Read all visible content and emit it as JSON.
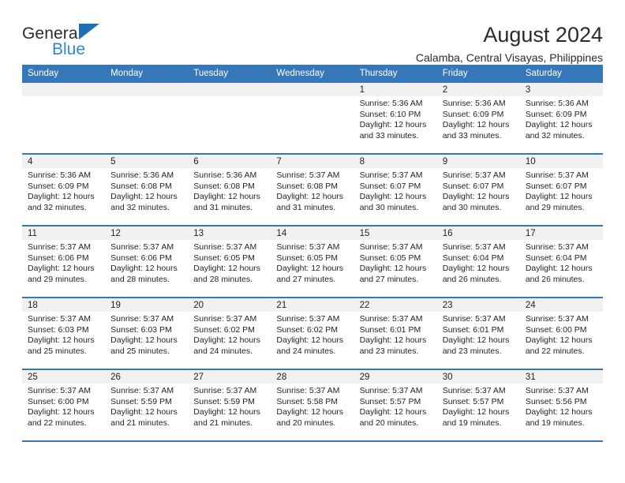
{
  "brand": {
    "name_top": "General",
    "name_bottom": "Blue",
    "triangle_color": "#1f6fb5",
    "text_color": "#2b2b2b",
    "accent_color": "#2e86d6"
  },
  "header": {
    "title": "August 2024",
    "subtitle": "Calamba, Central Visayas, Philippines"
  },
  "calendar": {
    "header_bg": "#3577b9",
    "header_text_color": "#ffffff",
    "daynum_band_bg": "#f1f1f1",
    "weekdays": [
      "Sunday",
      "Monday",
      "Tuesday",
      "Wednesday",
      "Thursday",
      "Friday",
      "Saturday"
    ],
    "weeks": [
      [
        {
          "day": "",
          "sunrise": "",
          "sunset": "",
          "daylight_line1": "",
          "daylight_line2": ""
        },
        {
          "day": "",
          "sunrise": "",
          "sunset": "",
          "daylight_line1": "",
          "daylight_line2": ""
        },
        {
          "day": "",
          "sunrise": "",
          "sunset": "",
          "daylight_line1": "",
          "daylight_line2": ""
        },
        {
          "day": "",
          "sunrise": "",
          "sunset": "",
          "daylight_line1": "",
          "daylight_line2": ""
        },
        {
          "day": "1",
          "sunrise": "Sunrise: 5:36 AM",
          "sunset": "Sunset: 6:10 PM",
          "daylight_line1": "Daylight: 12 hours",
          "daylight_line2": "and 33 minutes."
        },
        {
          "day": "2",
          "sunrise": "Sunrise: 5:36 AM",
          "sunset": "Sunset: 6:09 PM",
          "daylight_line1": "Daylight: 12 hours",
          "daylight_line2": "and 33 minutes."
        },
        {
          "day": "3",
          "sunrise": "Sunrise: 5:36 AM",
          "sunset": "Sunset: 6:09 PM",
          "daylight_line1": "Daylight: 12 hours",
          "daylight_line2": "and 32 minutes."
        }
      ],
      [
        {
          "day": "4",
          "sunrise": "Sunrise: 5:36 AM",
          "sunset": "Sunset: 6:09 PM",
          "daylight_line1": "Daylight: 12 hours",
          "daylight_line2": "and 32 minutes."
        },
        {
          "day": "5",
          "sunrise": "Sunrise: 5:36 AM",
          "sunset": "Sunset: 6:08 PM",
          "daylight_line1": "Daylight: 12 hours",
          "daylight_line2": "and 32 minutes."
        },
        {
          "day": "6",
          "sunrise": "Sunrise: 5:36 AM",
          "sunset": "Sunset: 6:08 PM",
          "daylight_line1": "Daylight: 12 hours",
          "daylight_line2": "and 31 minutes."
        },
        {
          "day": "7",
          "sunrise": "Sunrise: 5:37 AM",
          "sunset": "Sunset: 6:08 PM",
          "daylight_line1": "Daylight: 12 hours",
          "daylight_line2": "and 31 minutes."
        },
        {
          "day": "8",
          "sunrise": "Sunrise: 5:37 AM",
          "sunset": "Sunset: 6:07 PM",
          "daylight_line1": "Daylight: 12 hours",
          "daylight_line2": "and 30 minutes."
        },
        {
          "day": "9",
          "sunrise": "Sunrise: 5:37 AM",
          "sunset": "Sunset: 6:07 PM",
          "daylight_line1": "Daylight: 12 hours",
          "daylight_line2": "and 30 minutes."
        },
        {
          "day": "10",
          "sunrise": "Sunrise: 5:37 AM",
          "sunset": "Sunset: 6:07 PM",
          "daylight_line1": "Daylight: 12 hours",
          "daylight_line2": "and 29 minutes."
        }
      ],
      [
        {
          "day": "11",
          "sunrise": "Sunrise: 5:37 AM",
          "sunset": "Sunset: 6:06 PM",
          "daylight_line1": "Daylight: 12 hours",
          "daylight_line2": "and 29 minutes."
        },
        {
          "day": "12",
          "sunrise": "Sunrise: 5:37 AM",
          "sunset": "Sunset: 6:06 PM",
          "daylight_line1": "Daylight: 12 hours",
          "daylight_line2": "and 28 minutes."
        },
        {
          "day": "13",
          "sunrise": "Sunrise: 5:37 AM",
          "sunset": "Sunset: 6:05 PM",
          "daylight_line1": "Daylight: 12 hours",
          "daylight_line2": "and 28 minutes."
        },
        {
          "day": "14",
          "sunrise": "Sunrise: 5:37 AM",
          "sunset": "Sunset: 6:05 PM",
          "daylight_line1": "Daylight: 12 hours",
          "daylight_line2": "and 27 minutes."
        },
        {
          "day": "15",
          "sunrise": "Sunrise: 5:37 AM",
          "sunset": "Sunset: 6:05 PM",
          "daylight_line1": "Daylight: 12 hours",
          "daylight_line2": "and 27 minutes."
        },
        {
          "day": "16",
          "sunrise": "Sunrise: 5:37 AM",
          "sunset": "Sunset: 6:04 PM",
          "daylight_line1": "Daylight: 12 hours",
          "daylight_line2": "and 26 minutes."
        },
        {
          "day": "17",
          "sunrise": "Sunrise: 5:37 AM",
          "sunset": "Sunset: 6:04 PM",
          "daylight_line1": "Daylight: 12 hours",
          "daylight_line2": "and 26 minutes."
        }
      ],
      [
        {
          "day": "18",
          "sunrise": "Sunrise: 5:37 AM",
          "sunset": "Sunset: 6:03 PM",
          "daylight_line1": "Daylight: 12 hours",
          "daylight_line2": "and 25 minutes."
        },
        {
          "day": "19",
          "sunrise": "Sunrise: 5:37 AM",
          "sunset": "Sunset: 6:03 PM",
          "daylight_line1": "Daylight: 12 hours",
          "daylight_line2": "and 25 minutes."
        },
        {
          "day": "20",
          "sunrise": "Sunrise: 5:37 AM",
          "sunset": "Sunset: 6:02 PM",
          "daylight_line1": "Daylight: 12 hours",
          "daylight_line2": "and 24 minutes."
        },
        {
          "day": "21",
          "sunrise": "Sunrise: 5:37 AM",
          "sunset": "Sunset: 6:02 PM",
          "daylight_line1": "Daylight: 12 hours",
          "daylight_line2": "and 24 minutes."
        },
        {
          "day": "22",
          "sunrise": "Sunrise: 5:37 AM",
          "sunset": "Sunset: 6:01 PM",
          "daylight_line1": "Daylight: 12 hours",
          "daylight_line2": "and 23 minutes."
        },
        {
          "day": "23",
          "sunrise": "Sunrise: 5:37 AM",
          "sunset": "Sunset: 6:01 PM",
          "daylight_line1": "Daylight: 12 hours",
          "daylight_line2": "and 23 minutes."
        },
        {
          "day": "24",
          "sunrise": "Sunrise: 5:37 AM",
          "sunset": "Sunset: 6:00 PM",
          "daylight_line1": "Daylight: 12 hours",
          "daylight_line2": "and 22 minutes."
        }
      ],
      [
        {
          "day": "25",
          "sunrise": "Sunrise: 5:37 AM",
          "sunset": "Sunset: 6:00 PM",
          "daylight_line1": "Daylight: 12 hours",
          "daylight_line2": "and 22 minutes."
        },
        {
          "day": "26",
          "sunrise": "Sunrise: 5:37 AM",
          "sunset": "Sunset: 5:59 PM",
          "daylight_line1": "Daylight: 12 hours",
          "daylight_line2": "and 21 minutes."
        },
        {
          "day": "27",
          "sunrise": "Sunrise: 5:37 AM",
          "sunset": "Sunset: 5:59 PM",
          "daylight_line1": "Daylight: 12 hours",
          "daylight_line2": "and 21 minutes."
        },
        {
          "day": "28",
          "sunrise": "Sunrise: 5:37 AM",
          "sunset": "Sunset: 5:58 PM",
          "daylight_line1": "Daylight: 12 hours",
          "daylight_line2": "and 20 minutes."
        },
        {
          "day": "29",
          "sunrise": "Sunrise: 5:37 AM",
          "sunset": "Sunset: 5:57 PM",
          "daylight_line1": "Daylight: 12 hours",
          "daylight_line2": "and 20 minutes."
        },
        {
          "day": "30",
          "sunrise": "Sunrise: 5:37 AM",
          "sunset": "Sunset: 5:57 PM",
          "daylight_line1": "Daylight: 12 hours",
          "daylight_line2": "and 19 minutes."
        },
        {
          "day": "31",
          "sunrise": "Sunrise: 5:37 AM",
          "sunset": "Sunset: 5:56 PM",
          "daylight_line1": "Daylight: 12 hours",
          "daylight_line2": "and 19 minutes."
        }
      ]
    ]
  }
}
